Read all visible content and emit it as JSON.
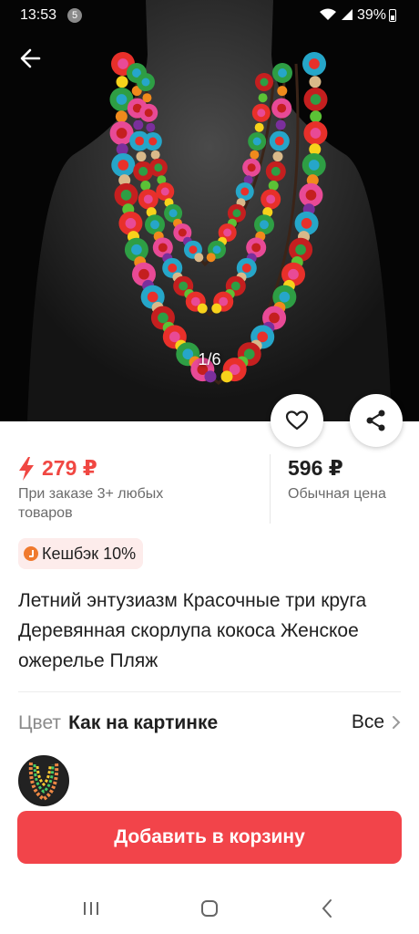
{
  "status_bar": {
    "time": "13:53",
    "notification_count": "5",
    "battery": "39%"
  },
  "gallery": {
    "counter": "1/6"
  },
  "price": {
    "promo_price": "279 ₽",
    "promo_note": "При заказе 3+ любых товаров",
    "regular_price": "596 ₽",
    "regular_label": "Обычная цена"
  },
  "cashback": {
    "label": "Кешбэк 10%"
  },
  "product": {
    "title": "Летний энтузиазм Красочные три круга Деревянная скорлупа кокоса Женское ожерелье Пляж"
  },
  "color": {
    "label": "Цвет",
    "value": "Как на картинке",
    "all_link": "Все"
  },
  "cart": {
    "button_label": "Добавить в корзину"
  },
  "colors": {
    "accent": "#f2444a",
    "price_red": "#f04742",
    "muted_text": "#6b6b6b",
    "cashback_bg": "#fdeceb"
  },
  "icons": [
    "back-arrow-icon",
    "heart-icon",
    "share-icon",
    "lightning-icon",
    "cashback-icon",
    "chevron-right-icon",
    "recent-apps-icon",
    "home-icon",
    "back-nav-icon"
  ]
}
